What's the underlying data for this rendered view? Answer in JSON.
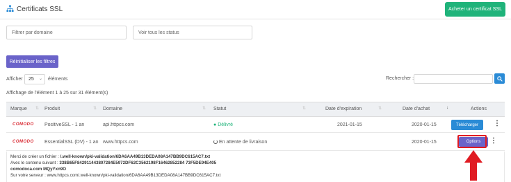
{
  "header": {
    "title": "Certificats SSL",
    "buy_button": "Acheter un certificat SSL"
  },
  "filters": {
    "domain_placeholder": "Filtrer par domaine",
    "status_placeholder": "Voir tous les status",
    "reset_button": "Réinitialiser les filtres"
  },
  "table_controls": {
    "show_label": "Afficher",
    "page_size": "25",
    "entries_label": "éléments",
    "search_label": "Rechercher :",
    "info": "Affichage de l'élément 1 à 25 sur 31 élément(s)"
  },
  "columns": [
    "Marque",
    "Produit",
    "Domaine",
    "Statut",
    "Date d'expiration",
    "Date d'achat",
    "Actions"
  ],
  "rows": [
    {
      "brand": "COMODO",
      "product": "PositiveSSL - 1 an",
      "domain": "api.httpcs.com",
      "status": "Délivré",
      "expiration": "2021-01-15",
      "purchase": "2020-01-15",
      "action": "Télécharger"
    },
    {
      "brand": "COMODO",
      "product": "EssentialSSL (DV) - 1 an",
      "domain": "www.httpcs.com",
      "status": "En attente de livraison",
      "expiration": "",
      "purchase": "2020-01-15",
      "action": "Options"
    }
  ],
  "detail": {
    "line1_prefix": "Merci de créer un fichier : ",
    "line1_path": "/.well-known/pki-validation/6DA6AA49B13DEDA08A147BB9DC615AC7.txt",
    "line2_prefix": "Avec le contenu suivant : ",
    "line2_hash": "338B65F842911443807284E5972DF62C3562198F16462852284 73F5DE94E405",
    "line3": "comodoca.com MQyYxn9O",
    "line4": "Sur votre serveur : www.httpcs.com/.well-known/pki-validation/6DA6AA49B13DEDA08A147BB9DC615AC7.txt"
  },
  "colors": {
    "green": "#1fb37a",
    "purple": "#6a63c9",
    "blue": "#2a8bd6",
    "comodo_red": "#d8262f",
    "annotation_red": "#e01b22",
    "status_green": "#1fb37a"
  }
}
